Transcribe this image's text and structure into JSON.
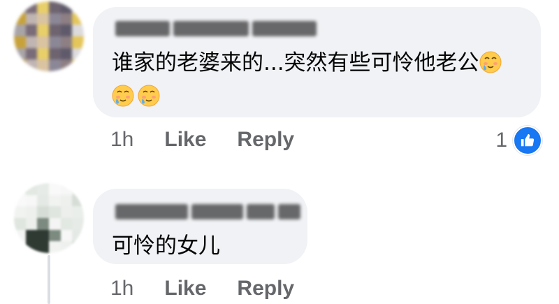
{
  "comments": [
    {
      "author": "Pang Hong Yong",
      "text": "谁家的老婆来的...突然有些可怜他老公",
      "emojis": [
        "smiling-face-with-tear-icon",
        "smiling-face-with-tear-icon",
        "smiling-face-with-tear-icon"
      ],
      "time": "1h",
      "like_label": "Like",
      "reply_label": "Reply",
      "reaction_count": "1",
      "reaction_icon": "like-icon"
    },
    {
      "author": "Raymon Tan Ja Yi",
      "text": "可怜的女儿",
      "time": "1h",
      "like_label": "Like",
      "reply_label": "Reply"
    }
  ],
  "colors": {
    "bubble": "#f0f2f5",
    "action_text": "#65676b",
    "body_text": "#050505",
    "like_blue": "#1877f2",
    "thread_line": "#dadde1"
  }
}
